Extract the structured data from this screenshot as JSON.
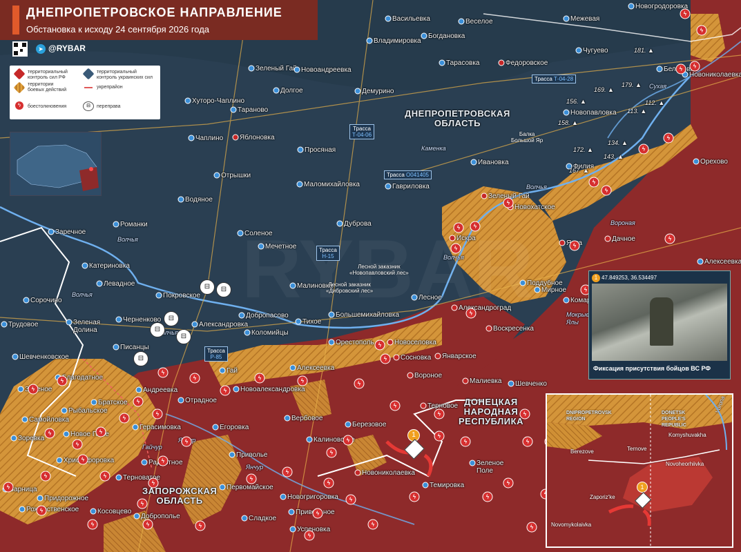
{
  "title": {
    "main": "ДНЕПРОПЕТРОВСКОЕ НАПРАВЛЕНИЕ",
    "subtitle": "Обстановка к исходу 24 сентября 2026 года"
  },
  "brand": {
    "name": "@RYBAR",
    "icons": [
      "qr-code-icon",
      "telegram-icon"
    ]
  },
  "legend": {
    "items": [
      {
        "label": "территориальный\nконтроль сил РФ",
        "color": "#c62828"
      },
      {
        "label": "территориальный\nконтроль украинских сил",
        "color": "#3a5a78"
      },
      {
        "label": "территории\nбоевых действий",
        "color": "#e2a23a"
      },
      {
        "label": "укрепрайон",
        "color": "#e05a5a"
      },
      {
        "label": "боестолкновения",
        "icon": "clash-icon"
      },
      {
        "label": "переправа",
        "icon": "crossing-icon"
      }
    ]
  },
  "colors": {
    "ru_control": "#8e2a2a",
    "ua_control": "#2a3f52",
    "contested": "#d4953a",
    "rivers": "#6fb0ef",
    "roads": "#e8b24a"
  },
  "regions": [
    {
      "name": "ДНЕПРОПЕТРОВСКАЯ\nОБЛАСТЬ"
    },
    {
      "name": "ДОНЕЦКАЯ\nНАРОДНАЯ\nРЕСПУБЛИКА"
    },
    {
      "name": "ЗАПОРОЖСКАЯ\nОБЛАСТЬ"
    }
  ],
  "settlements": [
    "Новогродоровка",
    "Межевая",
    "Васильевка",
    "Веселое",
    "Богдановка",
    "Владимировка",
    "Чугуево",
    "Беляковка",
    "Новониколаевка",
    "Зеленый Гай",
    "Новоандреевка",
    "Долгое",
    "Тарасовка",
    "Федоровское",
    "Демурино",
    "Хуторо-Чаплино",
    "Тараново",
    "Яблоновка",
    "Чаплино",
    "Просяная",
    "Ивановка",
    "Новопавловка",
    "Орехово",
    "Отрышки",
    "Маломихайловка",
    "Гавриловка",
    "Филия",
    "Водяное",
    "Зеленый Гай",
    "Новохатское",
    "Ялта",
    "Романки",
    "Заречное",
    "Соленое",
    "Мечетное",
    "Дуброва",
    "Искра",
    "Дачное",
    "Катериновка",
    "Алексеевка",
    "Поддубное",
    "Мирное",
    "Комар",
    "Левадное",
    "Малиновка",
    "Лесное",
    "Покровское",
    "Сорочино",
    "Черненково",
    "Добропасово",
    "Большемихайловка",
    "Александроград",
    "Воскресенка",
    "Трудовое",
    "Зеленая\nДолина",
    "Александровка",
    "Коломийцы",
    "Тихое",
    "Орестополь",
    "Новоселовка",
    "Писанцы",
    "Шевченковское",
    "Гай",
    "Сосновка",
    "Январское",
    "Благодатное",
    "Алексеевка",
    "Вороное",
    "Малиевка",
    "Шевченко",
    "Новоалександровка",
    "Зеленое",
    "Андреевка",
    "Братское",
    "Рыбальское",
    "Отрадное",
    "Терновое",
    "Самойловка",
    "Вербовое",
    "Березовое",
    "Герасимовка",
    "Егоровка",
    "Новое Поле",
    "Калиновское",
    "Зоревка",
    "Христофоровка",
    "Приволье",
    "Радостное",
    "Новониколаевка",
    "Зеленое\nПоле",
    "Терноватое",
    "Первомайское",
    "Темировка",
    "Зарница",
    "Придорожное",
    "Рождественское",
    "Новогригоровка",
    "Косовцево",
    "Привольное",
    "Доброполье",
    "Сладкое",
    "Успеновка"
  ],
  "roads": [
    {
      "label": "Трасса",
      "code": "Т-04-28"
    },
    {
      "label": "Трасса",
      "code": "Т-04-06"
    },
    {
      "label": "Трасса",
      "code": "О041405"
    },
    {
      "label": "Трасса",
      "code": "Н-15"
    },
    {
      "label": "Трасса",
      "code": "Р-85"
    }
  ],
  "rivers": [
    "Волчья",
    "Волчья",
    "Волчья",
    "Волчья",
    "Волчья",
    "Вороная",
    "Сухая",
    "Мокрые\nЯлы",
    "Янчур",
    "Янчур",
    "Гайчур",
    "Каменка"
  ],
  "forests": [
    "Балка\nБольшой Яр",
    "Лесной заказник\n«Новопавловский лес»",
    "Лесной заказник\n«Дибровский лес»"
  ],
  "heights": [
    "181.",
    "179.",
    "169.",
    "156.",
    "158.",
    "113.",
    "112.",
    "134.",
    "143.",
    "172.",
    "167."
  ],
  "photo_card": {
    "badge": "1",
    "coords": "47.849253, 36.534497",
    "caption": "Фиксация присутствия бойцов ВС РФ"
  },
  "detail_inset": {
    "regions": [
      "DNIPROPETROVSK\nREGION",
      "DONETSK\nPEOPLE'S\nREPUBLIC"
    ],
    "river": "Vorona",
    "settlements": [
      "Komyshuvakha",
      "Berezove",
      "Ternove",
      "Novoheorhiivka",
      "Zaporiz'ke",
      "Novomykolaivka"
    ],
    "badge": "1"
  },
  "marker_badge": "1",
  "watermark": "RYBAR"
}
